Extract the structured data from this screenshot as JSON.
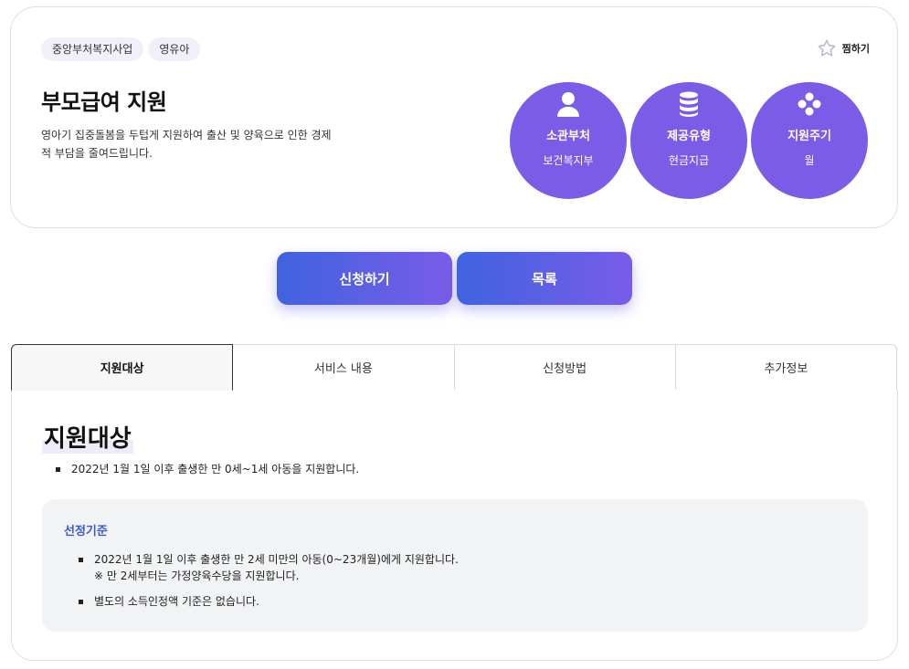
{
  "header": {
    "tags": [
      "중앙부처복지사업",
      "영유아"
    ],
    "favorite_label": "찜하기",
    "title": "부모급여 지원",
    "description": "영아기 집중돌봄을 두텁게 지원하여 출산 및 양육으로 인한 경제적 부담을 줄여드립니다."
  },
  "info_circles": [
    {
      "icon": "person-icon",
      "label": "소관부처",
      "value": "보건복지부"
    },
    {
      "icon": "coins-icon",
      "label": "제공유형",
      "value": "현금지급"
    },
    {
      "icon": "dots-cross-icon",
      "label": "지원주기",
      "value": "월"
    }
  ],
  "actions": {
    "apply_label": "신청하기",
    "list_label": "목록"
  },
  "tabs": [
    {
      "label": "지원대상",
      "active": true
    },
    {
      "label": "서비스 내용",
      "active": false
    },
    {
      "label": "신청방법",
      "active": false
    },
    {
      "label": "추가정보",
      "active": false
    }
  ],
  "content": {
    "section_title": "지원대상",
    "main_bullet": "2022년 1월 1일 이후 출생한 만 0세~1세 아동을 지원합니다.",
    "criteria_title": "선정기준",
    "criteria": [
      {
        "text": "2022년 1월 1일 이후 출생한 만 2세 미만의 아동(0~23개월)에게 지원합니다.",
        "note": "※ 만 2세부터는 가정양육수당을 지원합니다."
      },
      {
        "text": "별도의 소득인정액 기준은 없습니다.",
        "note": ""
      }
    ]
  },
  "colors": {
    "accent": "#7b5ce6",
    "button_gradient_start": "#3f63e0",
    "button_gradient_end": "#7a5ce8",
    "criteria_title": "#3c5ad8"
  }
}
